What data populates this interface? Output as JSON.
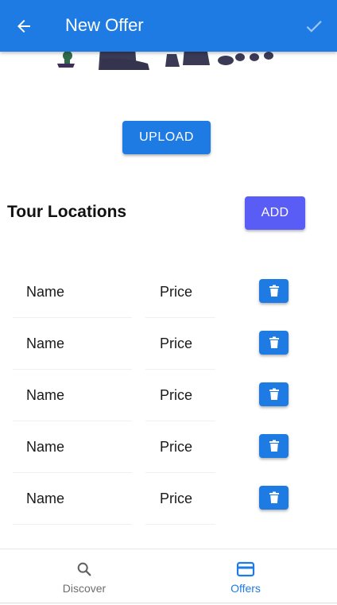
{
  "header": {
    "title": "New Offer",
    "back_icon": "arrow-back-icon",
    "confirm_icon": "checkmark-icon",
    "bg_color": "#1e7be3"
  },
  "upload": {
    "label": "UPLOAD"
  },
  "tour_locations": {
    "title": "Tour Locations",
    "add_label": "ADD",
    "add_color": "#5a5cf6",
    "rows": [
      {
        "name": "Name",
        "price": "Price",
        "delete_icon": "trash-icon"
      },
      {
        "name": "Name",
        "price": "Price",
        "delete_icon": "trash-icon"
      },
      {
        "name": "Name",
        "price": "Price",
        "delete_icon": "trash-icon"
      },
      {
        "name": "Name",
        "price": "Price",
        "delete_icon": "trash-icon"
      },
      {
        "name": "Name",
        "price": "Price",
        "delete_icon": "trash-icon"
      }
    ]
  },
  "bottom_nav": {
    "items": [
      {
        "label": "Discover",
        "icon": "search-icon",
        "active": false
      },
      {
        "label": "Offers",
        "icon": "credit-card-icon",
        "active": true
      }
    ],
    "active_color": "#1e7be3",
    "inactive_color": "#6e6e6e"
  }
}
